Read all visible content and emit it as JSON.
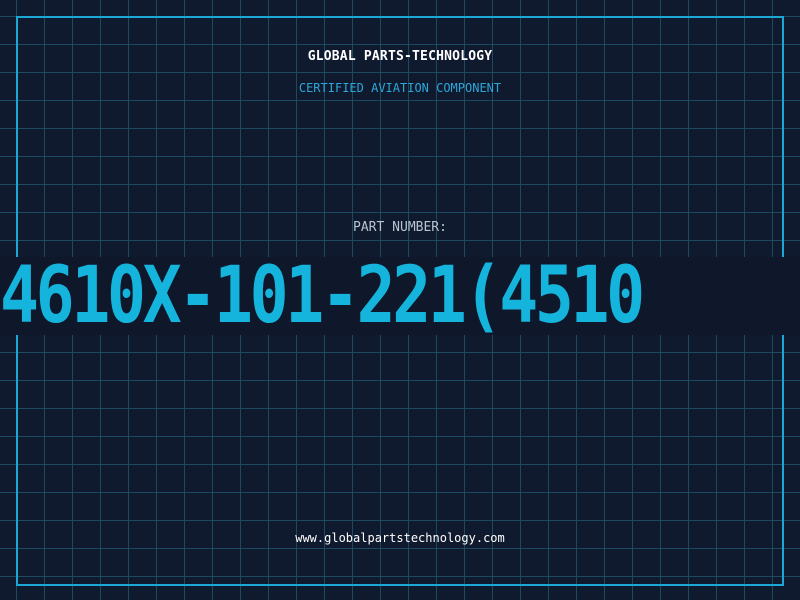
{
  "header": {
    "company": "GLOBAL PARTS-TECHNOLOGY",
    "subtitle": "CERTIFIED AVIATION COMPONENT"
  },
  "part": {
    "label": "PART NUMBER:",
    "number": "4610X-101-221(4510"
  },
  "footer": {
    "website": "www.globalpartstechnology.com"
  },
  "colors": {
    "background": "#101a2e",
    "grid": "#1d4a5e",
    "accent": "#14b4dc",
    "frame": "#1ba8d4"
  }
}
